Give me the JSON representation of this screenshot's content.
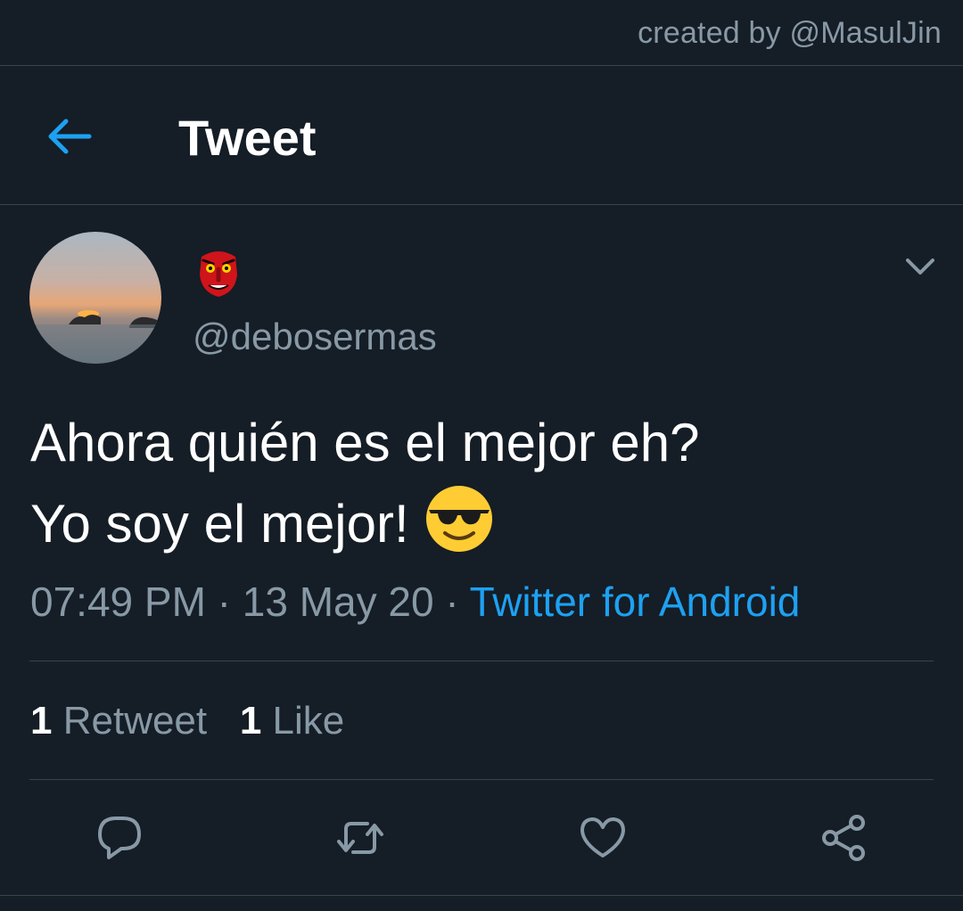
{
  "watermark": {
    "text": "created by @MasulJin"
  },
  "header": {
    "title": "Tweet",
    "back_icon": "arrow-left-icon"
  },
  "tweet": {
    "author": {
      "display_name_icon": "tengu-mask-emoji",
      "handle": "@debosermas",
      "avatar": "sunset-over-sea-photo"
    },
    "text_line_1": "Ahora quién es el mejor eh?",
    "text_line_2": "Yo soy el mejor!",
    "text_emoji": "smiling-face-with-sunglasses-emoji",
    "time": "07:49 PM",
    "date": "13 May 20",
    "separator": " · ",
    "source": "Twitter for Android",
    "stats": {
      "retweet_count": "1",
      "retweet_label": "Retweet",
      "like_count": "1",
      "like_label": "Like"
    }
  },
  "actions": {
    "reply_icon": "reply-icon",
    "retweet_icon": "retweet-icon",
    "like_icon": "heart-icon",
    "share_icon": "share-icon"
  },
  "colors": {
    "background": "#151d26",
    "divider": "#38444d",
    "secondary_text": "#8899a6",
    "accent": "#1da1f2",
    "primary_text": "#ffffff"
  }
}
